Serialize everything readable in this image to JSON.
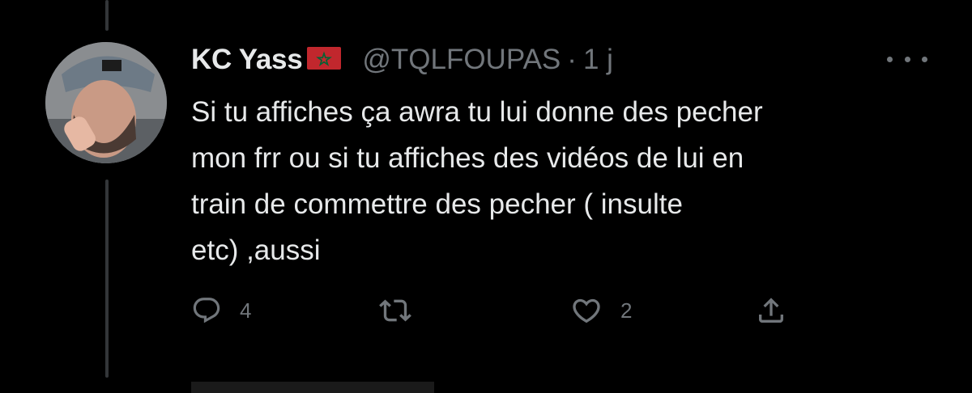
{
  "tweet": {
    "display_name": "KC Yass",
    "handle": "@TQLFOUPAS",
    "separator": "·",
    "time": "1 j",
    "text": "Si tu affiches ça awra tu lui donne des pecher\nmon frr ou si tu affiches des vidéos de lui en\ntrain de commettre des pecher ( insulte\netc) ,aussi",
    "reply_count": "4",
    "retweet_count": "",
    "like_count": "2"
  },
  "icons": {
    "flag": "morocco-flag-icon",
    "more": "more-dots-icon",
    "reply": "reply-icon",
    "retweet": "retweet-icon",
    "like": "heart-icon",
    "share": "share-icon"
  },
  "colors": {
    "background": "#000000",
    "text": "#e7e9ea",
    "secondary_text": "#71767b",
    "thread_line": "#333639",
    "flag_red": "#c1272d",
    "flag_star": "#006233"
  }
}
